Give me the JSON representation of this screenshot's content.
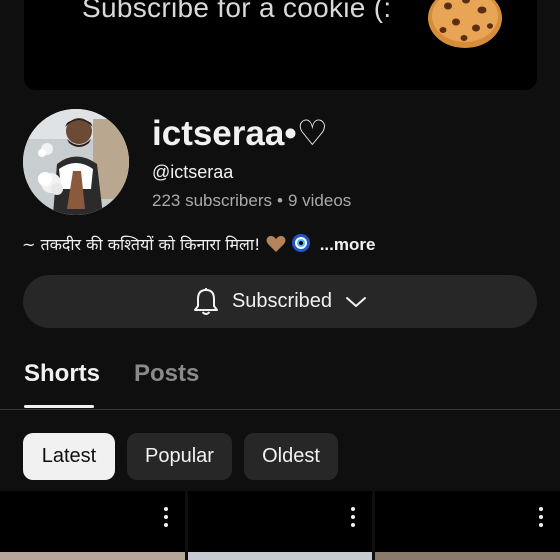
{
  "banner": {
    "text": "Subscribe for a cookie (:",
    "icon": "cookie-icon"
  },
  "channel": {
    "name": "ictseraa•♡",
    "handle": "@ictseraa",
    "subscribers": "223 subscribers",
    "separator": "•",
    "videos": "9 videos",
    "description": "~ तकदीर की कश्तियों को किनारा मिला!",
    "more_label": "...more"
  },
  "subscribe": {
    "label": "Subscribed",
    "icon": "bell-icon",
    "dropdown_icon": "chevron-down-icon"
  },
  "tabs": [
    {
      "label": "Shorts",
      "active": true
    },
    {
      "label": "Posts",
      "active": false
    }
  ],
  "filters": [
    {
      "label": "Latest",
      "selected": true
    },
    {
      "label": "Popular",
      "selected": false
    },
    {
      "label": "Oldest",
      "selected": false
    }
  ],
  "colors": {
    "background": "#0f0f0f",
    "surface": "#272727",
    "text": "#f1f1f1",
    "muted": "#aaaaaa"
  }
}
